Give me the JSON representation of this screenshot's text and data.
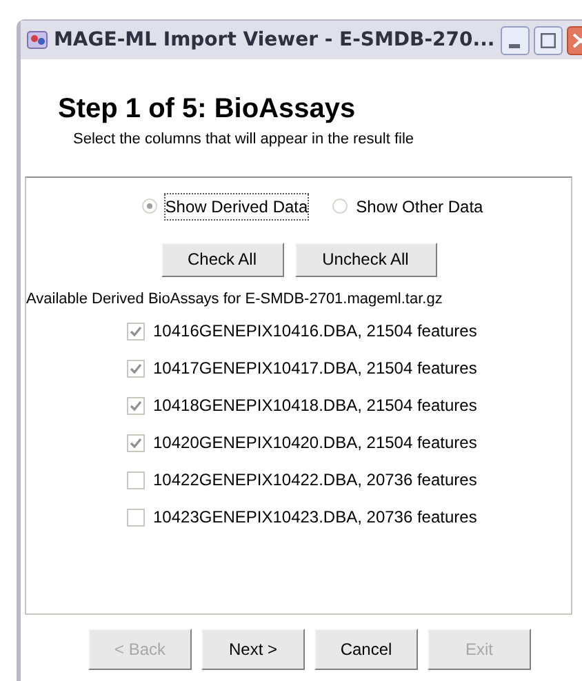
{
  "window": {
    "title": "MAGE-ML Import Viewer - E-SMDB-270..."
  },
  "heading": "Step 1 of 5: BioAssays",
  "subheading": "Select the columns that will appear in the result file",
  "data_options": [
    {
      "label": "Show Derived Data",
      "selected": true
    },
    {
      "label": "Show Other Data",
      "selected": false
    }
  ],
  "check_buttons": [
    "Check All",
    "Uncheck All"
  ],
  "list_caption": "Available Derived BioAssays for E-SMDB-2701.mageml.tar.gz",
  "bioassays": [
    {
      "label": "10416GENEPIX10416.DBA, 21504 features",
      "checked": true
    },
    {
      "label": "10417GENEPIX10417.DBA, 21504 features",
      "checked": true
    },
    {
      "label": "10418GENEPIX10418.DBA, 21504 features",
      "checked": true
    },
    {
      "label": "10420GENEPIX10420.DBA, 21504 features",
      "checked": true
    },
    {
      "label": "10422GENEPIX10422.DBA, 20736 features",
      "checked": false
    },
    {
      "label": "10423GENEPIX10423.DBA, 20736 features",
      "checked": false
    }
  ],
  "nav_buttons": [
    {
      "label": "< Back",
      "disabled": true
    },
    {
      "label": "Next >",
      "disabled": false
    },
    {
      "label": "Cancel",
      "disabled": false
    },
    {
      "label": "Exit",
      "disabled": true
    }
  ]
}
